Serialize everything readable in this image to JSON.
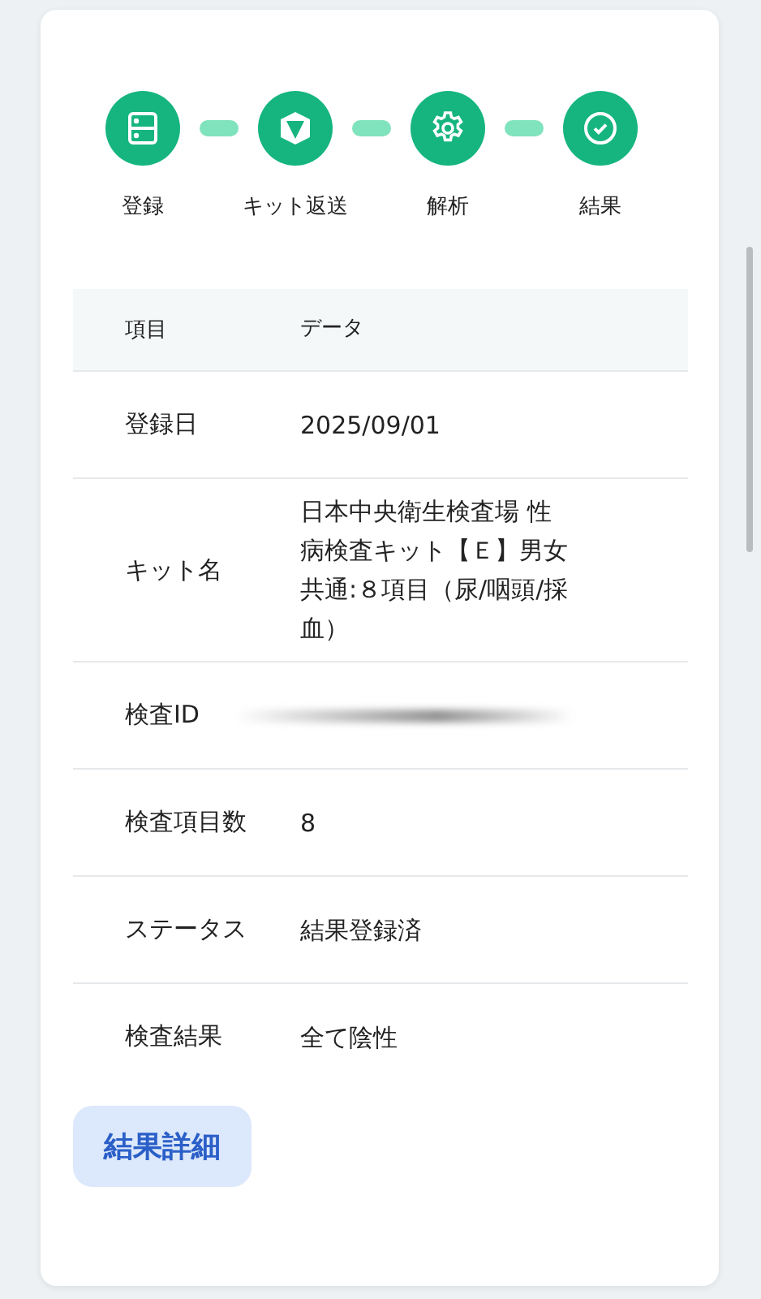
{
  "steps": [
    {
      "label": "登録",
      "done": true
    },
    {
      "label": "キット返送",
      "done": true
    },
    {
      "label": "解析",
      "done": true
    },
    {
      "label": "結果",
      "done": true
    }
  ],
  "table": {
    "columns": [
      "項目",
      "データ"
    ],
    "rows": [
      {
        "label": "登録日",
        "value": "2025/09/01"
      },
      {
        "label": "キット名",
        "value": "日本中央衛生検査場 性病検査キット【Ｅ】男女共通:８項目（尿/咽頭/採血）"
      },
      {
        "label": "検査ID",
        "redacted": true
      },
      {
        "label": "検査項目数",
        "value": "8"
      },
      {
        "label": "ステータス",
        "value": "結果登録済"
      },
      {
        "label": "検査結果",
        "value": "全て陰性"
      }
    ]
  },
  "button": {
    "label": "結果詳細"
  }
}
